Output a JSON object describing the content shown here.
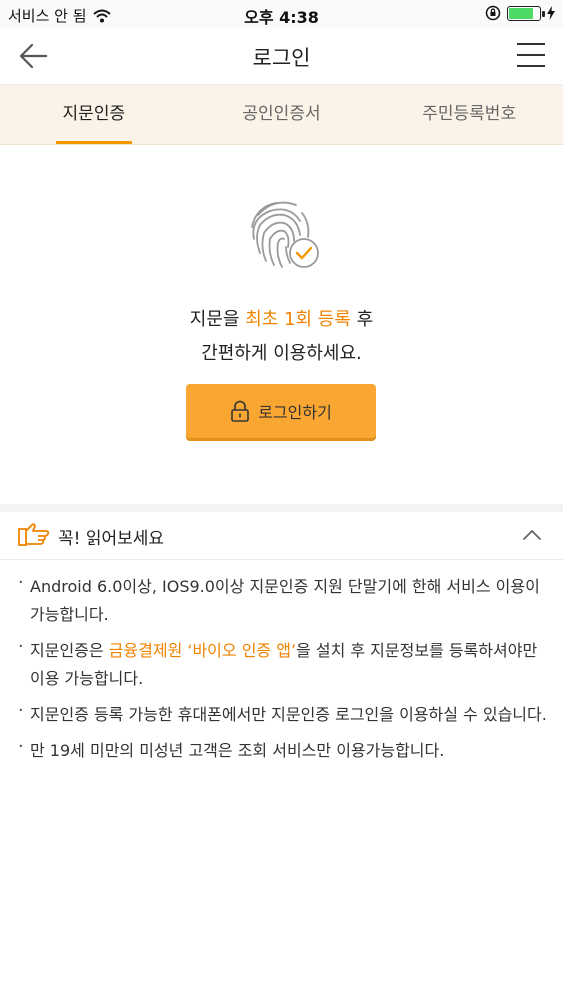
{
  "status_bar": {
    "carrier": "서비스 안 됨",
    "time": "오후 4:38",
    "battery_level": 0.8
  },
  "header": {
    "title": "로그인",
    "back_icon": "arrow-left-icon",
    "menu_icon": "hamburger-menu-icon"
  },
  "tabs": [
    {
      "label": "지문인증",
      "active": true
    },
    {
      "label": "공인인증서",
      "active": false
    },
    {
      "label": "주민등록번호",
      "active": false
    }
  ],
  "fingerprint": {
    "line1_pre": "지문을 ",
    "line1_highlight": "최초 1회 등록",
    "line1_post": " 후",
    "line2": "간편하게 이용하세요.",
    "login_button": "로그인하기",
    "accent_color": "#f08300",
    "button_color": "#f9a632"
  },
  "notice": {
    "title": "꼭! 읽어보세요",
    "items": [
      {
        "text": "Android 6.0이상, IOS9.0이상 지문인증 지원 단말기에 한해 서비스 이용이 가능합니다."
      },
      {
        "pre": "지문인증은 ",
        "highlight": "금융결제원 ‘바이오 인증 앱’",
        "post": "을 설치 후 지문정보를 등록하셔야만 이용 가능합니다."
      },
      {
        "text": "지문인증 등록 가능한 휴대폰에서만 지문인증 로그인을 이용하실 수 있습니다."
      },
      {
        "text": "만 19세 미만의 미성년 고객은 조회 서비스만 이용가능합니다."
      }
    ]
  }
}
